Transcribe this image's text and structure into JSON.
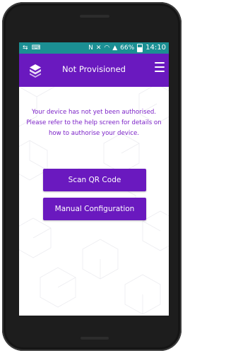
{
  "statusbar": {
    "left_icons": [
      "usb-icon",
      "keyboard-icon"
    ],
    "right_icons": [
      "nfc-icon",
      "mute-icon",
      "wifi-icon",
      "signal-icon"
    ],
    "battery": "66%",
    "time": "14:10"
  },
  "appbar": {
    "title": "Not Provisioned",
    "logo_icon": "app-logo-icon",
    "menu_icon": "hamburger-menu-icon"
  },
  "main": {
    "message": "Your device has not yet been authorised. Please refer to the help screen for details on how to authorise your device.",
    "scan_button": "Scan QR Code",
    "manual_button": "Manual Configuration"
  },
  "colors": {
    "primary": "#6a19bf",
    "statusbar": "#1b8f93",
    "message_text": "#7a1fc7",
    "background": "#ffffff"
  }
}
